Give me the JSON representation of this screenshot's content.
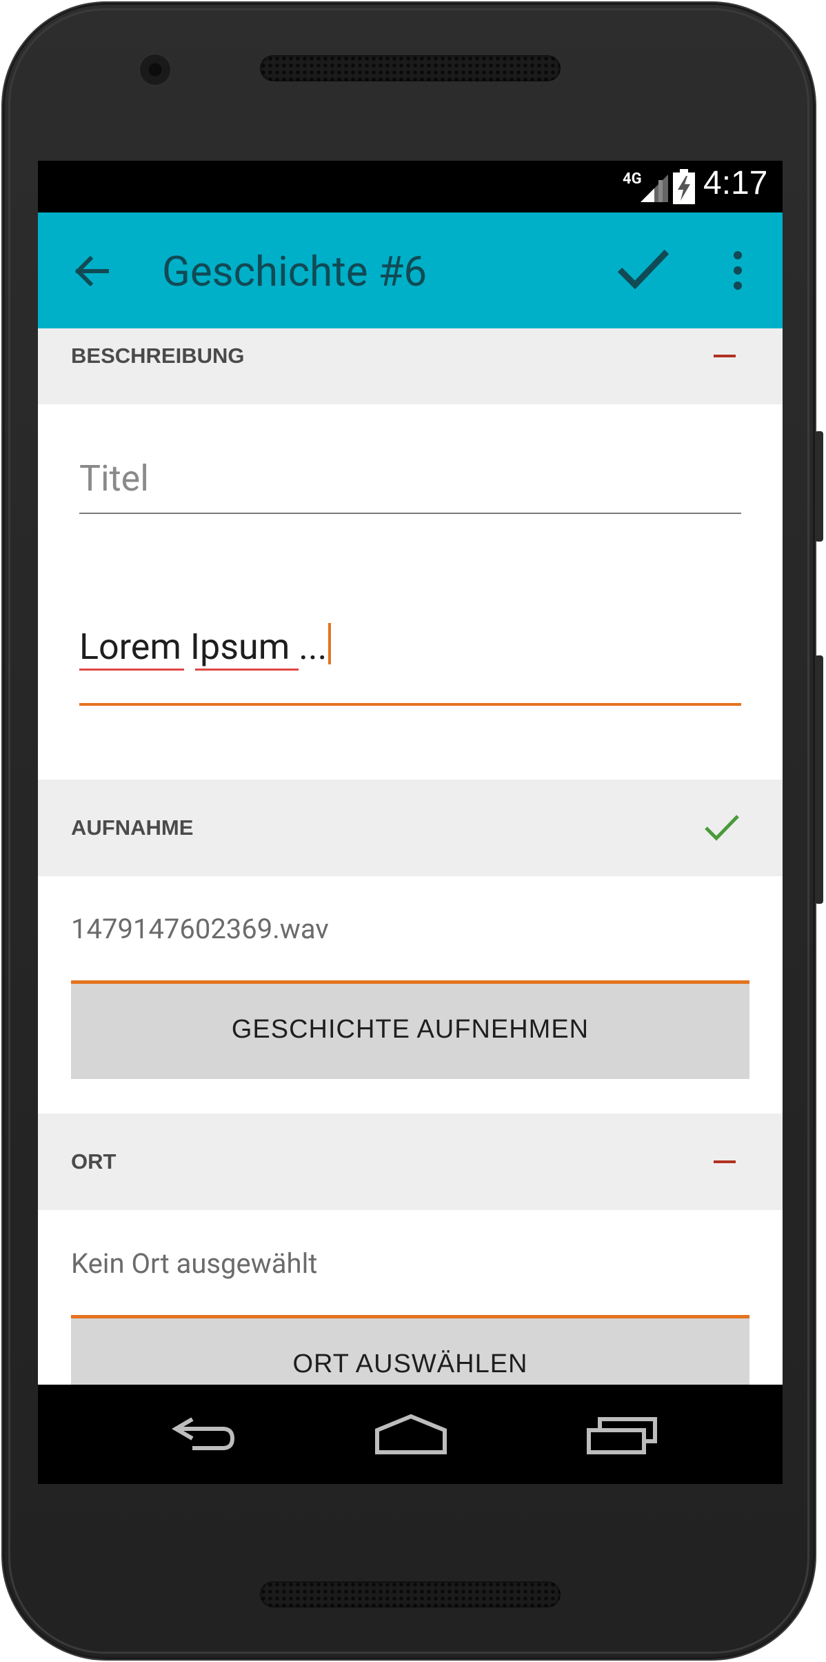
{
  "status_bar": {
    "network": "4G",
    "time": "4:17"
  },
  "app_bar": {
    "title": "Geschichte #6",
    "back_icon": "arrow-left-icon",
    "confirm_icon": "check-icon",
    "overflow_icon": "more-vert-icon"
  },
  "sections": {
    "description": {
      "header": "BESCHREIBUNG",
      "state_icon": "minus-icon",
      "title_placeholder": "Titel",
      "body_value": "Lorem Ipsum ..."
    },
    "recording": {
      "header": "AUFNAHME",
      "state_icon": "check-icon",
      "file_name": "1479147602369.wav",
      "button_label": "GESCHICHTE AUFNEHMEN"
    },
    "location": {
      "header": "ORT",
      "state_icon": "minus-icon",
      "status_text": "Kein Ort ausgewählt",
      "button_label": "ORT AUSWÄHLEN"
    }
  },
  "nav_bar": {
    "back_icon": "nav-back-icon",
    "home_icon": "nav-home-icon",
    "recents_icon": "nav-recents-icon"
  },
  "colors": {
    "app_bar": "#00b0c8",
    "accent": "#e4731f",
    "title_text": "#114a55",
    "check_green": "#4a9a3a",
    "minus_red": "#b23121",
    "section_bg": "#eeeeee",
    "button_bg": "#d6d6d6"
  }
}
